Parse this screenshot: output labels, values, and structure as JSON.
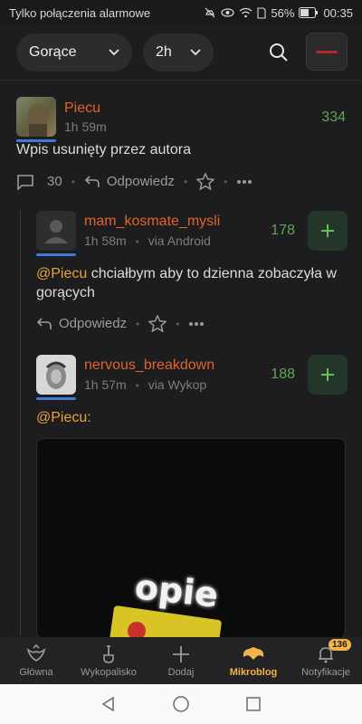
{
  "status_bar": {
    "carrier": "Tylko połączenia alarmowe",
    "battery": "56%",
    "time": "00:35"
  },
  "filters": {
    "sort": "Gorące",
    "period": "2h"
  },
  "post": {
    "username": "Piecu",
    "time": "1h 59m",
    "score": "334",
    "text": "Wpis usunięty przez autora",
    "comments_count": "30",
    "reply_label": "Odpowiedz"
  },
  "comments": [
    {
      "username": "mam_kosmate_mysli",
      "time": "1h 58m",
      "via": "via Android",
      "score": "178",
      "mention": "@Piecu",
      "text": " chciałbym aby to dzienna zobaczyła w gorących",
      "reply_label": "Odpowiedz"
    },
    {
      "username": "nervous_breakdown",
      "time": "1h 57m",
      "via": "via Wykop",
      "score": "188",
      "mention": "@Piecu:",
      "image_text": "opie"
    }
  ],
  "bottom_nav": [
    {
      "label": "Główna"
    },
    {
      "label": "Wykopalisko"
    },
    {
      "label": "Dodaj"
    },
    {
      "label": "Mikroblog"
    },
    {
      "label": "Notyfikacje",
      "badge": "136"
    }
  ],
  "colors": {
    "accent": "#f2b44a",
    "username": "#e0632a",
    "score": "#5fa64e",
    "mention": "#e8a43a"
  }
}
